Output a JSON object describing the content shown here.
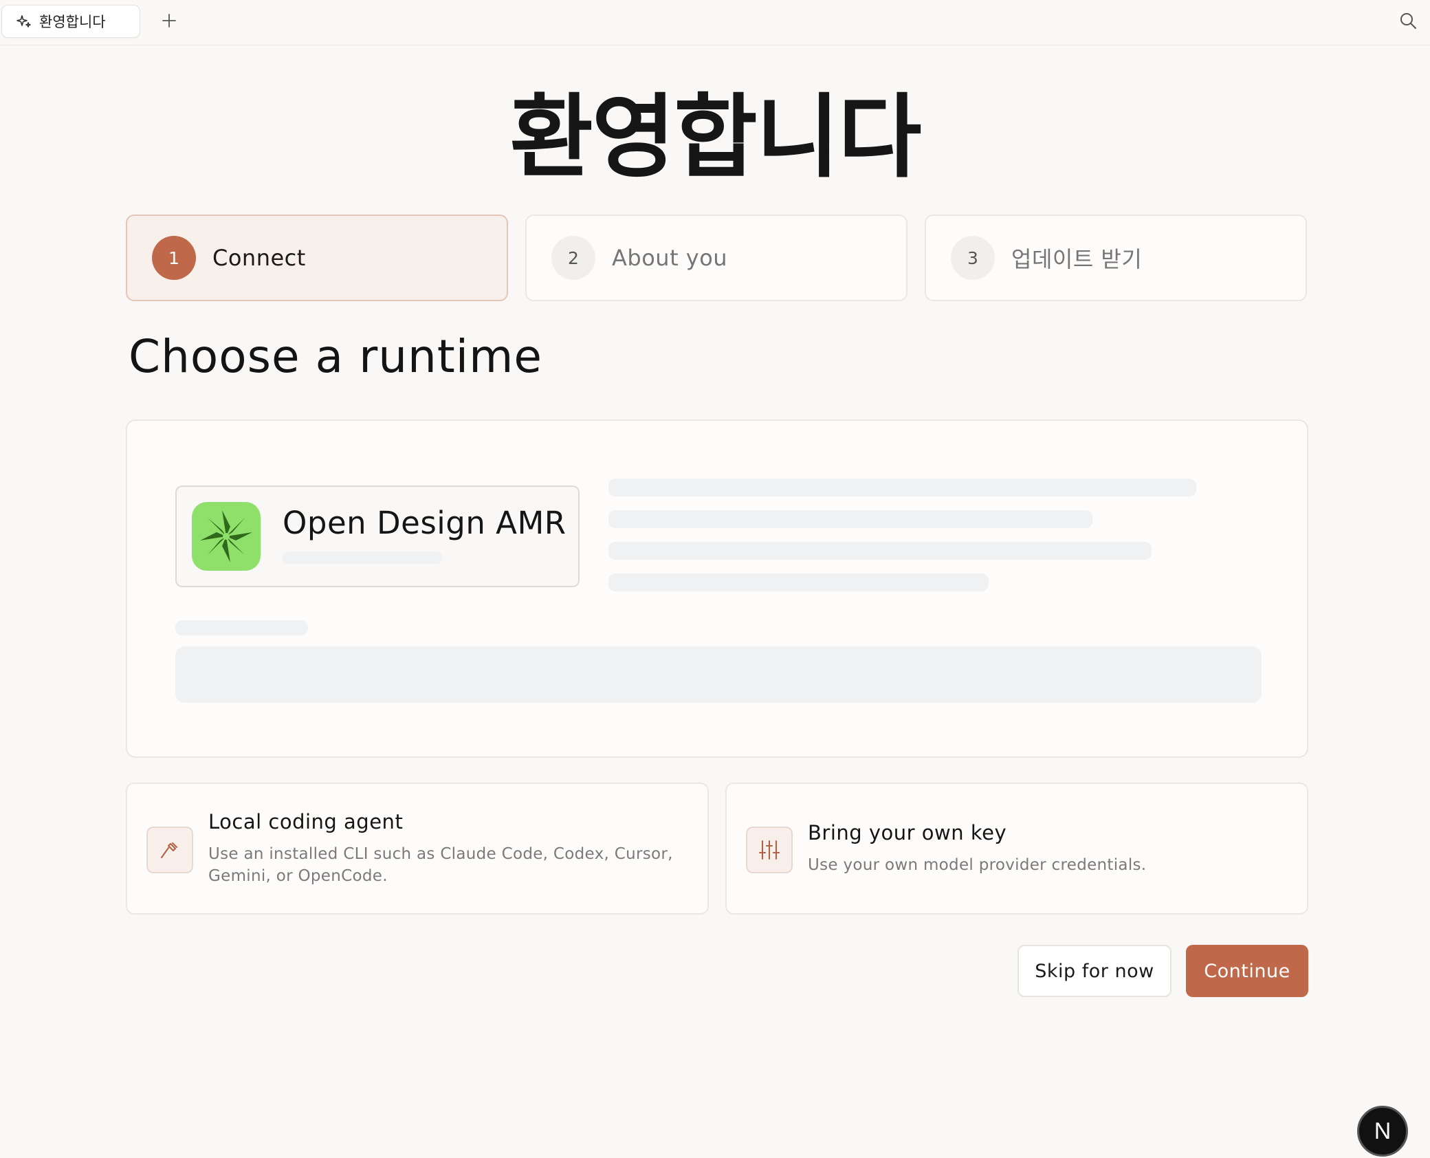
{
  "tab": {
    "icon": "sparkle-icon",
    "label": "환영합니다"
  },
  "toolbar": {
    "new_tab_icon": "plus-icon",
    "search_icon": "search-icon"
  },
  "page": {
    "title": "환영합니다"
  },
  "steps": [
    {
      "number": "1",
      "label": "Connect",
      "active": true
    },
    {
      "number": "2",
      "label": "About you",
      "active": false
    },
    {
      "number": "3",
      "label": "업데이트 받기",
      "active": false
    }
  ],
  "runtime": {
    "heading": "Choose a runtime",
    "selected": {
      "name": "Open Design AMR",
      "logo": "open-design-logo"
    }
  },
  "options": [
    {
      "icon": "hammer-icon",
      "title": "Local coding agent",
      "description": "Use an installed CLI such as Claude Code, Codex, Cursor, Gemini, or OpenCode."
    },
    {
      "icon": "sliders-icon",
      "title": "Bring your own key",
      "description": "Use your own model provider credentials."
    }
  ],
  "actions": {
    "skip_label": "Skip for now",
    "continue_label": "Continue"
  },
  "fab": {
    "label": "N"
  },
  "colors": {
    "accent": "#c0684a",
    "background": "#f9f8f6",
    "logo_green": "#8fe06a"
  }
}
